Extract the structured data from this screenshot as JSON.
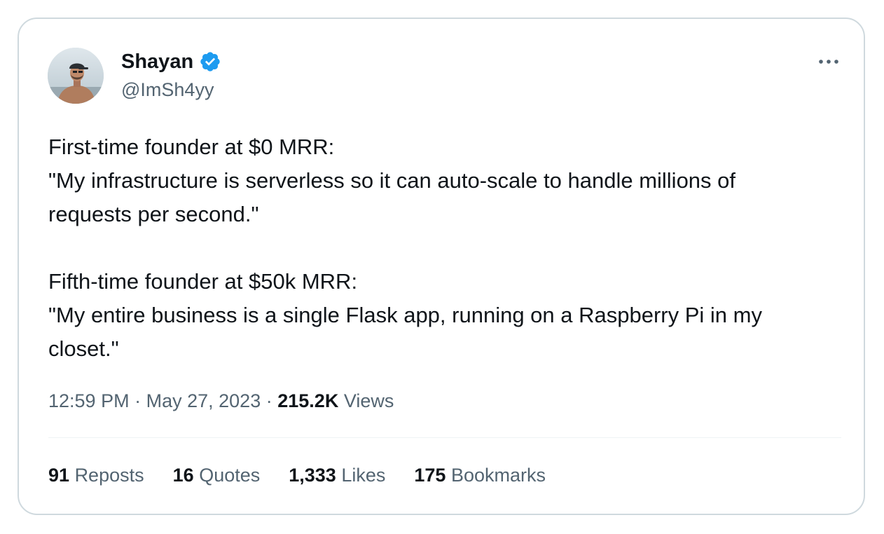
{
  "author": {
    "name": "Shayan",
    "handle": "@ImSh4yy",
    "verified": true,
    "avatar_icon": "avatar-photo"
  },
  "tweet": {
    "lines": [
      "First-time founder at $0 MRR:",
      "\"My infrastructure is serverless so it can auto-scale to handle millions of",
      "requests per second.\"",
      "",
      "Fifth-time founder at $50k MRR:",
      "\"My entire business is a single Flask app, running on a Raspberry Pi in my",
      "closet.\""
    ]
  },
  "meta": {
    "time": "12:59 PM",
    "separator": "·",
    "date": "May 27, 2023",
    "views_count": "215.2K",
    "views_label": "Views"
  },
  "stats": {
    "reposts": {
      "count": "91",
      "label": "Reposts"
    },
    "quotes": {
      "count": "16",
      "label": "Quotes"
    },
    "likes": {
      "count": "1,333",
      "label": "Likes"
    },
    "bookmarks": {
      "count": "175",
      "label": "Bookmarks"
    }
  },
  "colors": {
    "text": "#0f1419",
    "secondary": "#536471",
    "verified_badge": "#1d9bf0",
    "border": "#cfd9de"
  },
  "icons": {
    "verified": "verified-badge-icon",
    "more": "more-options-icon"
  }
}
